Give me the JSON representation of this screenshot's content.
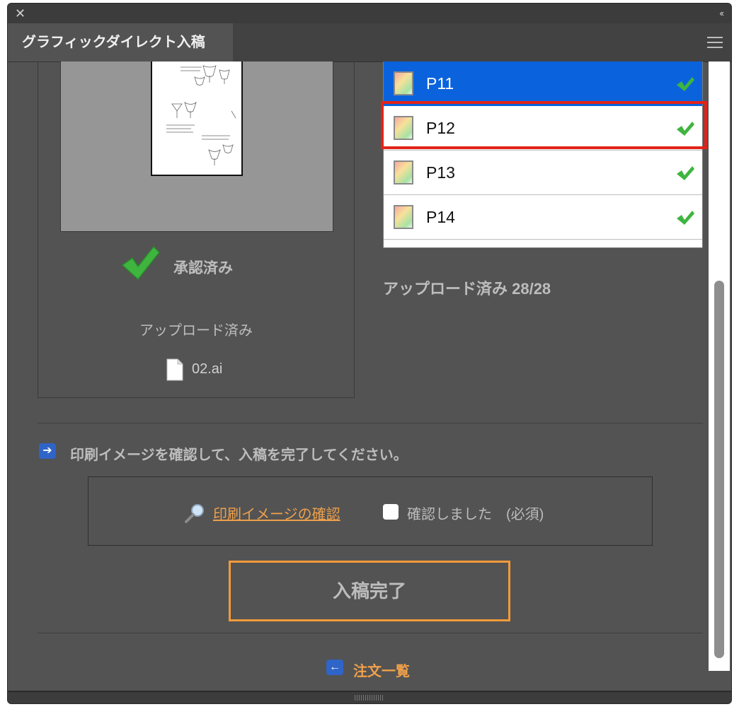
{
  "window": {
    "tab_title": "グラフィックダイレクト入稿"
  },
  "preview": {
    "status_label": "承認済み",
    "upload_status": "アップロード済み",
    "file_name": "02.ai"
  },
  "page_list": {
    "items": [
      {
        "label": "P11",
        "selected": true,
        "checked": true
      },
      {
        "label": "P12",
        "selected": false,
        "checked": true,
        "highlighted": true
      },
      {
        "label": "P13",
        "selected": false,
        "checked": true
      },
      {
        "label": "P14",
        "selected": false,
        "checked": true
      }
    ],
    "upload_count": "アップロード済み 28/28"
  },
  "instruction": {
    "text": "印刷イメージを確認して、入稿を完了してください。"
  },
  "confirm": {
    "preview_link": "印刷イメージの確認",
    "checkbox_label": "確認しました　(必須)",
    "checked": false
  },
  "actions": {
    "submit_label": "入稿完了",
    "back_label": "注文一覧"
  },
  "colors": {
    "panel_bg": "#535353",
    "selected_row": "#0a63dd",
    "accent_orange": "#f19a3a",
    "highlight_red": "#e2231a",
    "check_green": "#3fb53f"
  }
}
